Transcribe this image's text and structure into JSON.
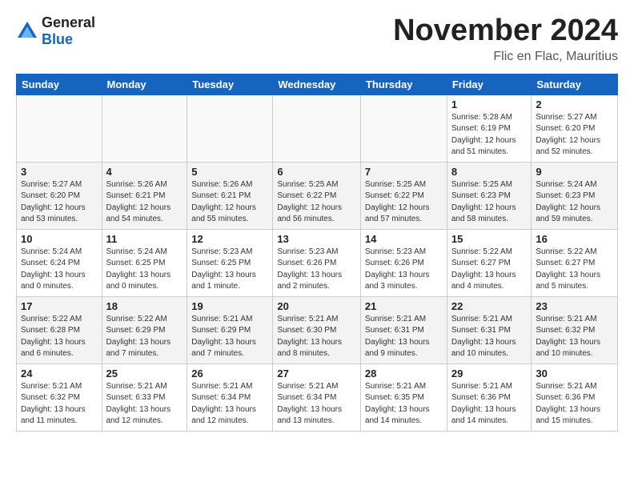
{
  "header": {
    "logo_general": "General",
    "logo_blue": "Blue",
    "title": "November 2024",
    "subtitle": "Flic en Flac, Mauritius"
  },
  "weekdays": [
    "Sunday",
    "Monday",
    "Tuesday",
    "Wednesday",
    "Thursday",
    "Friday",
    "Saturday"
  ],
  "weeks": [
    [
      {
        "day": "",
        "info": ""
      },
      {
        "day": "",
        "info": ""
      },
      {
        "day": "",
        "info": ""
      },
      {
        "day": "",
        "info": ""
      },
      {
        "day": "",
        "info": ""
      },
      {
        "day": "1",
        "info": "Sunrise: 5:28 AM\nSunset: 6:19 PM\nDaylight: 12 hours\nand 51 minutes."
      },
      {
        "day": "2",
        "info": "Sunrise: 5:27 AM\nSunset: 6:20 PM\nDaylight: 12 hours\nand 52 minutes."
      }
    ],
    [
      {
        "day": "3",
        "info": "Sunrise: 5:27 AM\nSunset: 6:20 PM\nDaylight: 12 hours\nand 53 minutes."
      },
      {
        "day": "4",
        "info": "Sunrise: 5:26 AM\nSunset: 6:21 PM\nDaylight: 12 hours\nand 54 minutes."
      },
      {
        "day": "5",
        "info": "Sunrise: 5:26 AM\nSunset: 6:21 PM\nDaylight: 12 hours\nand 55 minutes."
      },
      {
        "day": "6",
        "info": "Sunrise: 5:25 AM\nSunset: 6:22 PM\nDaylight: 12 hours\nand 56 minutes."
      },
      {
        "day": "7",
        "info": "Sunrise: 5:25 AM\nSunset: 6:22 PM\nDaylight: 12 hours\nand 57 minutes."
      },
      {
        "day": "8",
        "info": "Sunrise: 5:25 AM\nSunset: 6:23 PM\nDaylight: 12 hours\nand 58 minutes."
      },
      {
        "day": "9",
        "info": "Sunrise: 5:24 AM\nSunset: 6:23 PM\nDaylight: 12 hours\nand 59 minutes."
      }
    ],
    [
      {
        "day": "10",
        "info": "Sunrise: 5:24 AM\nSunset: 6:24 PM\nDaylight: 13 hours\nand 0 minutes."
      },
      {
        "day": "11",
        "info": "Sunrise: 5:24 AM\nSunset: 6:25 PM\nDaylight: 13 hours\nand 0 minutes."
      },
      {
        "day": "12",
        "info": "Sunrise: 5:23 AM\nSunset: 6:25 PM\nDaylight: 13 hours\nand 1 minute."
      },
      {
        "day": "13",
        "info": "Sunrise: 5:23 AM\nSunset: 6:26 PM\nDaylight: 13 hours\nand 2 minutes."
      },
      {
        "day": "14",
        "info": "Sunrise: 5:23 AM\nSunset: 6:26 PM\nDaylight: 13 hours\nand 3 minutes."
      },
      {
        "day": "15",
        "info": "Sunrise: 5:22 AM\nSunset: 6:27 PM\nDaylight: 13 hours\nand 4 minutes."
      },
      {
        "day": "16",
        "info": "Sunrise: 5:22 AM\nSunset: 6:27 PM\nDaylight: 13 hours\nand 5 minutes."
      }
    ],
    [
      {
        "day": "17",
        "info": "Sunrise: 5:22 AM\nSunset: 6:28 PM\nDaylight: 13 hours\nand 6 minutes."
      },
      {
        "day": "18",
        "info": "Sunrise: 5:22 AM\nSunset: 6:29 PM\nDaylight: 13 hours\nand 7 minutes."
      },
      {
        "day": "19",
        "info": "Sunrise: 5:21 AM\nSunset: 6:29 PM\nDaylight: 13 hours\nand 7 minutes."
      },
      {
        "day": "20",
        "info": "Sunrise: 5:21 AM\nSunset: 6:30 PM\nDaylight: 13 hours\nand 8 minutes."
      },
      {
        "day": "21",
        "info": "Sunrise: 5:21 AM\nSunset: 6:31 PM\nDaylight: 13 hours\nand 9 minutes."
      },
      {
        "day": "22",
        "info": "Sunrise: 5:21 AM\nSunset: 6:31 PM\nDaylight: 13 hours\nand 10 minutes."
      },
      {
        "day": "23",
        "info": "Sunrise: 5:21 AM\nSunset: 6:32 PM\nDaylight: 13 hours\nand 10 minutes."
      }
    ],
    [
      {
        "day": "24",
        "info": "Sunrise: 5:21 AM\nSunset: 6:32 PM\nDaylight: 13 hours\nand 11 minutes."
      },
      {
        "day": "25",
        "info": "Sunrise: 5:21 AM\nSunset: 6:33 PM\nDaylight: 13 hours\nand 12 minutes."
      },
      {
        "day": "26",
        "info": "Sunrise: 5:21 AM\nSunset: 6:34 PM\nDaylight: 13 hours\nand 12 minutes."
      },
      {
        "day": "27",
        "info": "Sunrise: 5:21 AM\nSunset: 6:34 PM\nDaylight: 13 hours\nand 13 minutes."
      },
      {
        "day": "28",
        "info": "Sunrise: 5:21 AM\nSunset: 6:35 PM\nDaylight: 13 hours\nand 14 minutes."
      },
      {
        "day": "29",
        "info": "Sunrise: 5:21 AM\nSunset: 6:36 PM\nDaylight: 13 hours\nand 14 minutes."
      },
      {
        "day": "30",
        "info": "Sunrise: 5:21 AM\nSunset: 6:36 PM\nDaylight: 13 hours\nand 15 minutes."
      }
    ]
  ]
}
